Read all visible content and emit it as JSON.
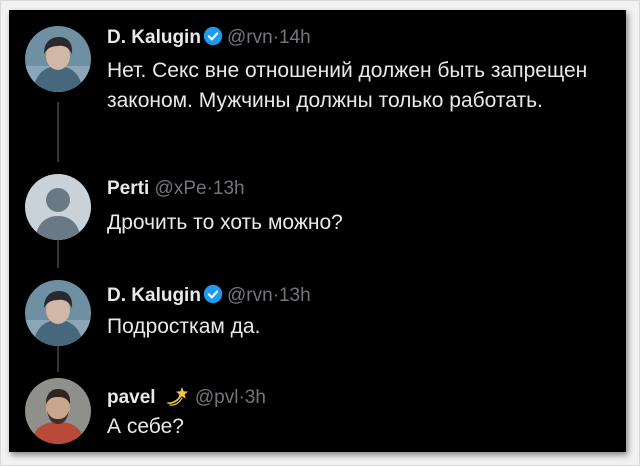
{
  "tweets": [
    {
      "name": "D. Kalugin",
      "handle": "@rvn",
      "sep": "·",
      "time": "14h",
      "text": "Нет. Секс вне отношений должен быть запрещен законом. Мужчины должны только работать."
    },
    {
      "name": "Perti",
      "handle": "@xPe",
      "sep": "·",
      "time": "13h",
      "text": "Дрочить то хоть можно?"
    },
    {
      "name": "D. Kalugin",
      "handle": "@rvn",
      "sep": "·",
      "time": "13h",
      "text": "Подросткам да."
    },
    {
      "name": "pavel",
      "handle": "@pvl",
      "sep": "·",
      "time": "3h",
      "text": "А себе?"
    }
  ],
  "colors": {
    "background": "#000000",
    "text": "#e7e9ea",
    "muted": "#71767b",
    "verified": "#1d9bf0",
    "thread_line": "#333639"
  },
  "icons": {
    "verified": "verified-badge-icon",
    "emoji": "dizzy-emoji-icon"
  }
}
